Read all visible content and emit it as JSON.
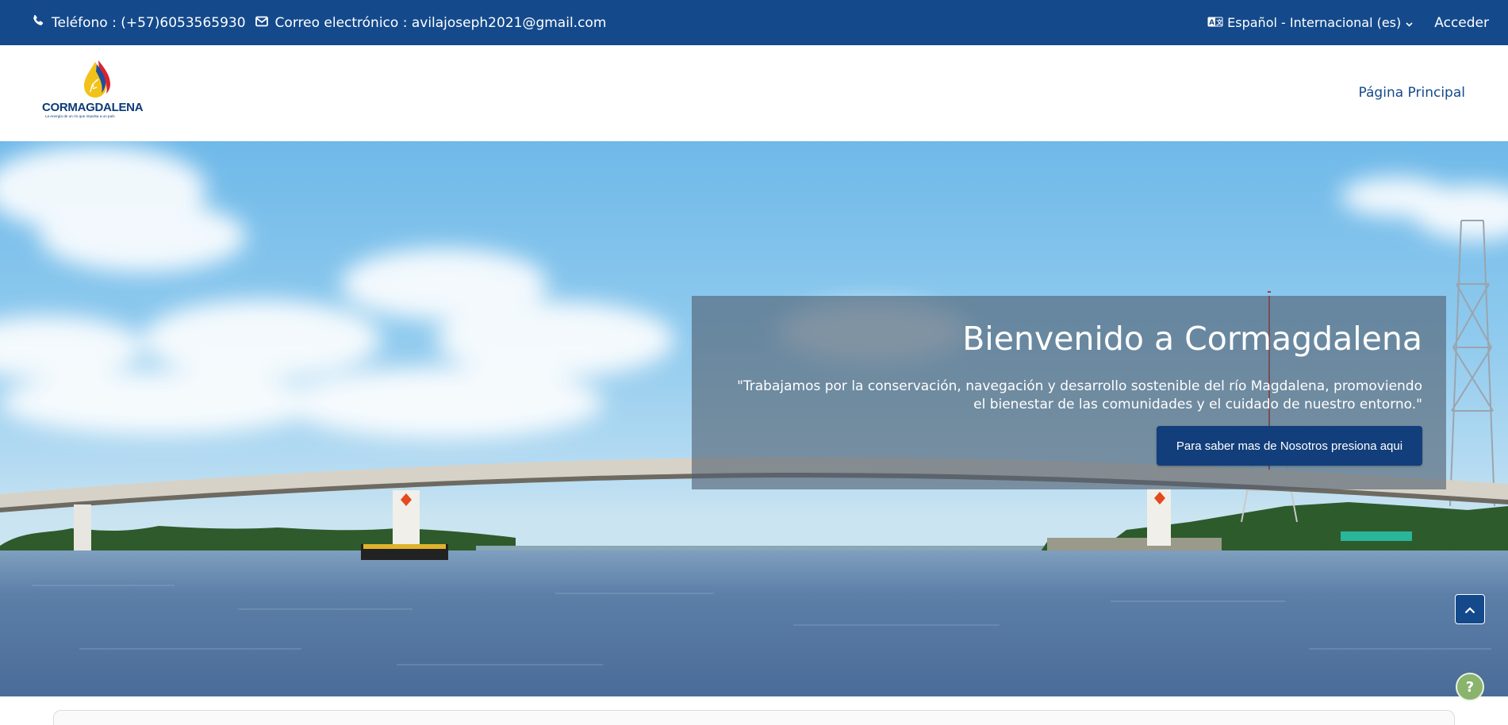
{
  "topbar": {
    "phone_text": "Teléfono : (+57)6053565930",
    "email_text": "Correo electrónico : avilajoseph2021@gmail.com",
    "language_label": "Español - Internacional (es)",
    "login_label": "Acceder",
    "icons": {
      "phone": "phone-icon",
      "email": "envelope-icon",
      "language": "language-icon",
      "dropdown": "chevron-down-icon"
    }
  },
  "navbar": {
    "logo_text": "CORMAGDALENA",
    "logo_tagline": "La energía de un río que impulsa a un país",
    "links": [
      "Página Principal"
    ]
  },
  "hero": {
    "title": "Bienvenido a Cormagdalena",
    "subtitle": "\"Trabajamos por la conservación, navegación y desarrollo sostenible del río Magdalena, promoviendo el bienestar de las comunidades y el cuidado de nuestro entorno.\"",
    "cta_label": "Para saber mas de Nosotros presiona aqui"
  },
  "floating": {
    "scroll_top_icon": "chevron-up-icon",
    "help_label": "?"
  },
  "colors": {
    "primary": "#144a8c",
    "button": "#123f7b",
    "help": "#8ab36d"
  }
}
